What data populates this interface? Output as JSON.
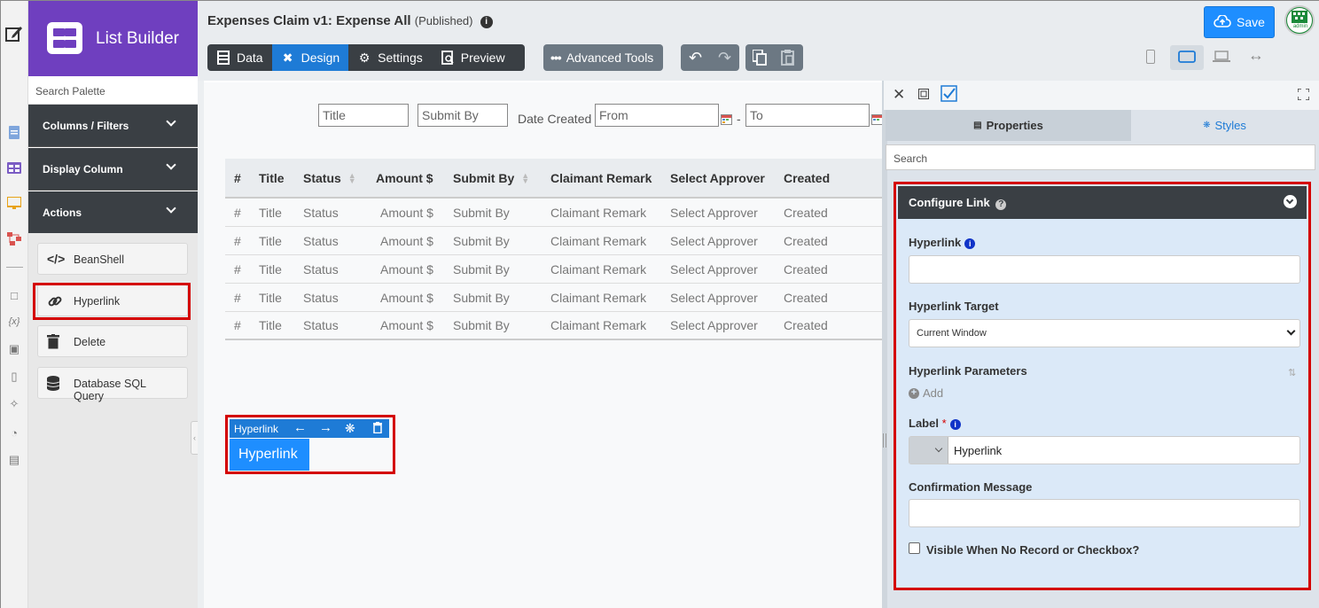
{
  "palette": {
    "brand_title": "List Builder",
    "search_placeholder": "Search Palette",
    "sections": [
      "Columns / Filters",
      "Display Column",
      "Actions"
    ],
    "items": [
      "BeanShell",
      "Hyperlink",
      "Delete",
      "Database SQL Query"
    ]
  },
  "header": {
    "title": "Expenses Claim v1: Expense All",
    "status": "(Published)",
    "tabs": [
      "Data",
      "Design",
      "Settings",
      "Preview"
    ],
    "active_tab": "Design",
    "advanced_tools": "Advanced Tools",
    "save": "Save",
    "avatar_text": "admin"
  },
  "filters": {
    "title": "Title",
    "submit_by": "Submit By",
    "date_created": "Date Created",
    "from": "From",
    "to": "To",
    "dash": "-"
  },
  "table": {
    "columns": [
      "#",
      "Title",
      "Status",
      "Amount $",
      "Submit By",
      "Claimant Remark",
      "Select Approver",
      "Created"
    ],
    "rows": [
      [
        "#",
        "Title",
        "Status",
        "Amount $",
        "Submit By",
        "Claimant Remark",
        "Select Approver",
        "Created"
      ],
      [
        "#",
        "Title",
        "Status",
        "Amount $",
        "Submit By",
        "Claimant Remark",
        "Select Approver",
        "Created"
      ],
      [
        "#",
        "Title",
        "Status",
        "Amount $",
        "Submit By",
        "Claimant Remark",
        "Select Approver",
        "Created"
      ],
      [
        "#",
        "Title",
        "Status",
        "Amount $",
        "Submit By",
        "Claimant Remark",
        "Select Approver",
        "Created"
      ],
      [
        "#",
        "Title",
        "Status",
        "Amount $",
        "Submit By",
        "Claimant Remark",
        "Select Approver",
        "Created"
      ]
    ]
  },
  "widget": {
    "bar_label": "Hyperlink",
    "button_label": "Hyperlink"
  },
  "panel": {
    "tabs": [
      "Properties",
      "Styles"
    ],
    "search_placeholder": "Search",
    "section_title": "Configure Link",
    "hyperlink_label": "Hyperlink",
    "hyperlink_value": "",
    "target_label": "Hyperlink Target",
    "target_value": "Current Window",
    "params_label": "Hyperlink Parameters",
    "add_label": "Add",
    "label_label": "Label",
    "required_mark": "*",
    "label_value": "Hyperlink",
    "confirm_label": "Confirmation Message",
    "confirm_value": "",
    "visible_label": "Visible When No Record or Checkbox?"
  },
  "colors": {
    "brand": "#6f3fbf",
    "accent": "#1e7bd6",
    "highlight": "#d40000",
    "dark": "#3a3f44"
  }
}
